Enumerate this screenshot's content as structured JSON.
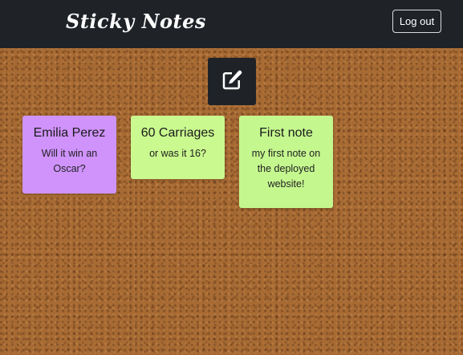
{
  "app": {
    "brand": "Sticky Notes",
    "logout_label": "Log out"
  },
  "toolbar": {
    "new_note_icon": "edit-note-icon"
  },
  "colors": {
    "navbar": "#1f2328",
    "note_purple": "#cf93fb",
    "note_green": "#caf98f"
  },
  "notes": [
    {
      "title": "Emilia Perez",
      "body": "Will it win an Oscar?",
      "color": "#cf93fb"
    },
    {
      "title": "60 Carriages",
      "body": "or was it 16?",
      "color": "#caf98f"
    },
    {
      "title": "First note",
      "body": "my first note on the deployed website!",
      "color": "#c5f78f"
    }
  ]
}
